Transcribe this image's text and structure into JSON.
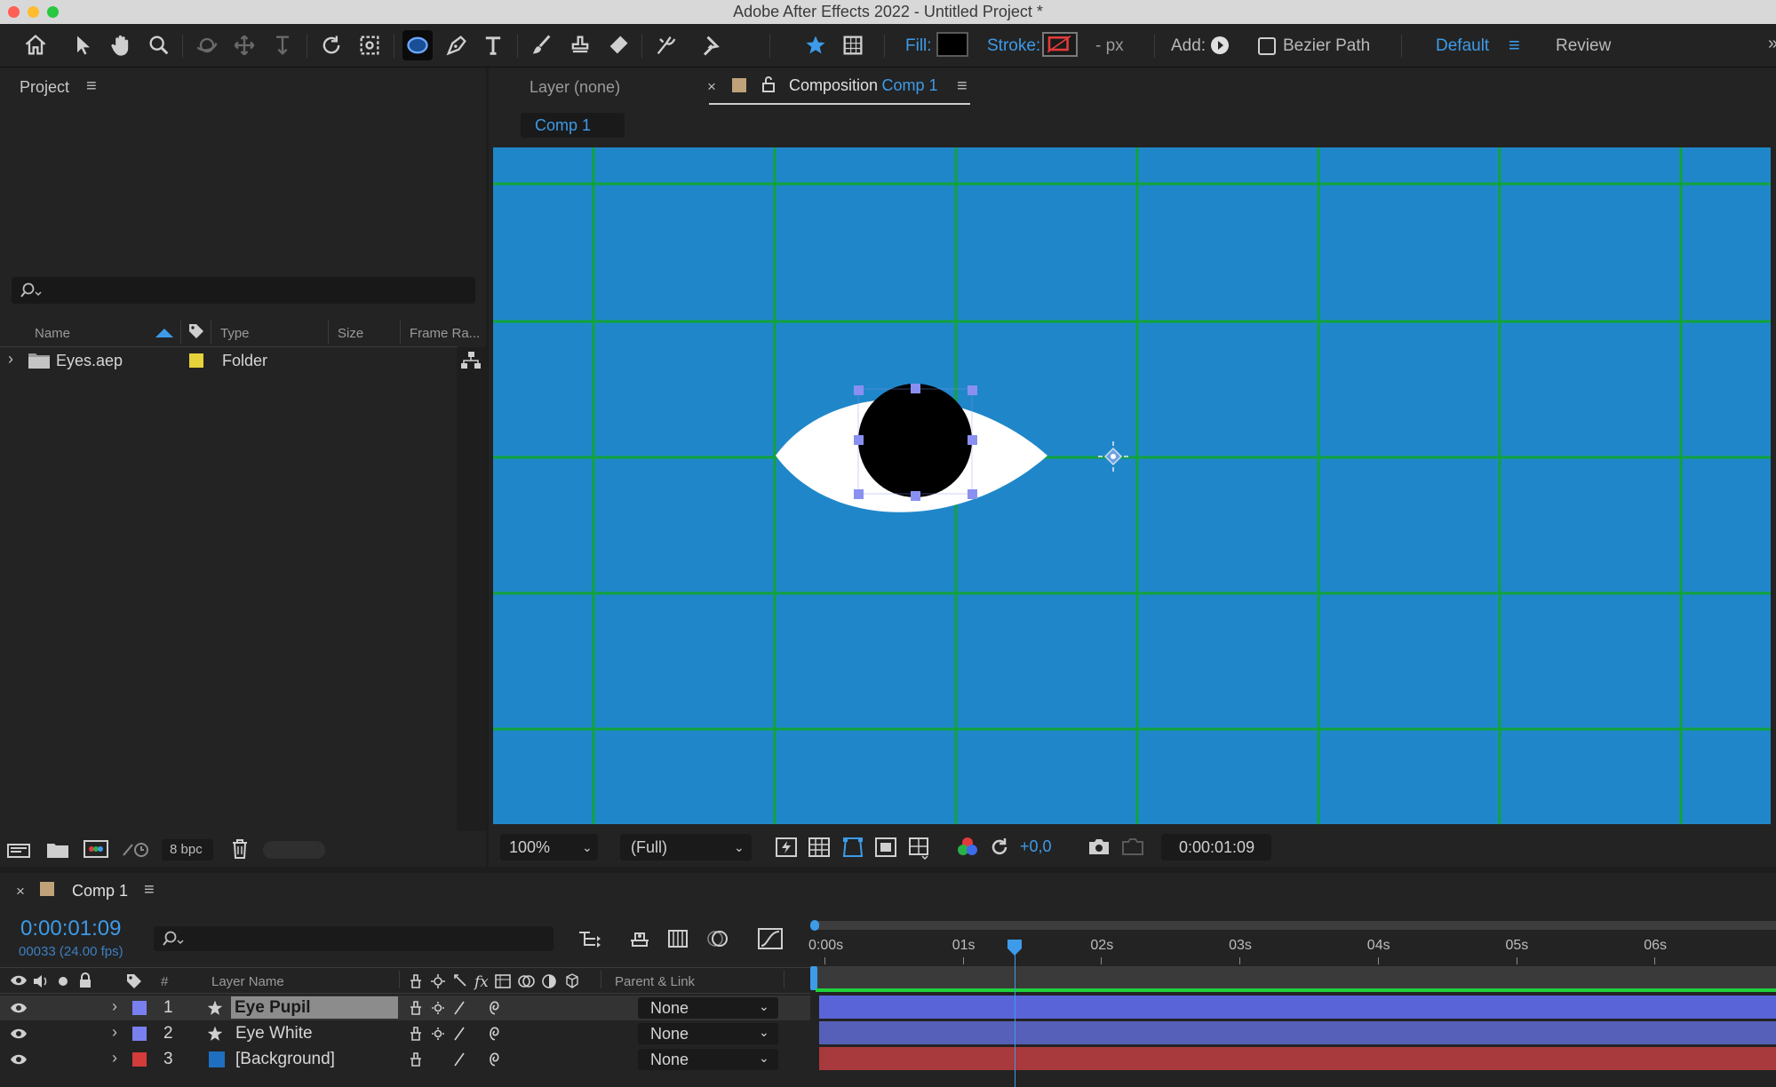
{
  "window": {
    "title": "Adobe After Effects 2022 - Untitled Project *"
  },
  "toolbar": {
    "fill_label": "Fill:",
    "stroke_label": "Stroke:",
    "stroke_width": "- px",
    "add_label": "Add:",
    "bezier_label": "Bezier Path",
    "workspace_default": "Default",
    "workspace_review": "Review",
    "colors": {
      "fill": "#000000",
      "stroke_none": "#e23b3b",
      "accent": "#3d9be9"
    }
  },
  "project": {
    "title": "Project",
    "columns": [
      "Name",
      "Type",
      "Size",
      "Frame Ra..."
    ],
    "items": [
      {
        "name": "Eyes.aep",
        "type": "Folder",
        "label_color": "#e6d23a"
      }
    ],
    "bpc": "8 bpc"
  },
  "comp_viewer": {
    "layer_tab": "Layer (none)",
    "comp_tab_prefix": "Composition",
    "comp_tab_name": "Comp 1",
    "breadcrumb": "Comp 1",
    "background_color": "#1f87c9",
    "grid_color": "#11a33a",
    "zoom": "100%",
    "resolution": "(Full)",
    "exposure": "+0,0",
    "timecode": "0:00:01:09"
  },
  "timeline": {
    "comp_name": "Comp 1",
    "current_time": "0:00:01:09",
    "frame_info": "00033 (24.00 fps)",
    "col_hash": "#",
    "col_layer_name": "Layer Name",
    "col_parent": "Parent & Link",
    "ruler": [
      "0:00s",
      "01s",
      "02s",
      "03s",
      "04s",
      "05s",
      "06s"
    ],
    "playhead_seconds": 1.375,
    "layers": [
      {
        "index": "1",
        "name": "Eye Pupil",
        "label_color": "#7a7ff0",
        "parent": "None",
        "bar_color": "#5a64d9"
      },
      {
        "index": "2",
        "name": "Eye White",
        "label_color": "#7a7ff0",
        "parent": "None",
        "bar_color": "#5660b8"
      },
      {
        "index": "3",
        "name": "[Background]",
        "label_color": "#d43b3b",
        "parent": "None",
        "bar_color": "#a8393d"
      }
    ]
  }
}
